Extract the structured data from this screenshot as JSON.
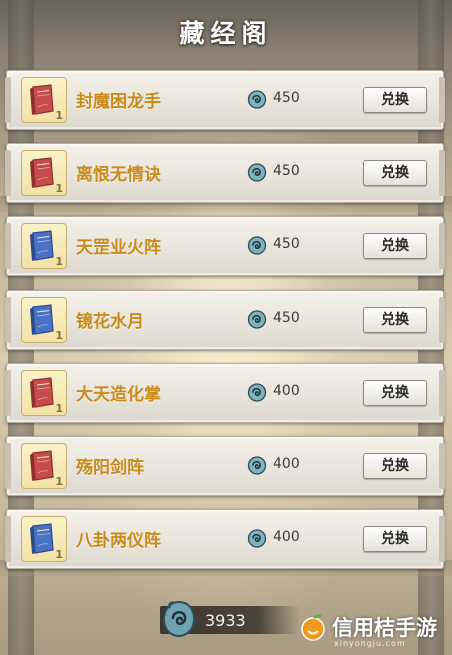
{
  "header": {
    "title": "藏经阁"
  },
  "items": [
    {
      "name": "封魔困龙手",
      "cost": "450",
      "button": "兑换",
      "book_color": "red",
      "count": "1"
    },
    {
      "name": "离恨无情诀",
      "cost": "450",
      "button": "兑换",
      "book_color": "red",
      "count": "1"
    },
    {
      "name": "天罡业火阵",
      "cost": "450",
      "button": "兑换",
      "book_color": "blue",
      "count": "1"
    },
    {
      "name": "镜花水月",
      "cost": "450",
      "button": "兑换",
      "book_color": "blue",
      "count": "1"
    },
    {
      "name": "大天造化掌",
      "cost": "400",
      "button": "兑换",
      "book_color": "red",
      "count": "1"
    },
    {
      "name": "殇阳剑阵",
      "cost": "400",
      "button": "兑换",
      "book_color": "red",
      "count": "1"
    },
    {
      "name": "八卦两仪阵",
      "cost": "400",
      "button": "兑换",
      "book_color": "blue",
      "count": "1"
    }
  ],
  "footer": {
    "balance": "3933",
    "currency_icon": "spirit-coin-icon"
  },
  "watermark": {
    "text": "信用桔手游",
    "url": "xinyongju.com"
  },
  "colors": {
    "item_name": "#c98b1c",
    "book_red": "#c74b4b",
    "book_blue": "#4a72c4"
  }
}
